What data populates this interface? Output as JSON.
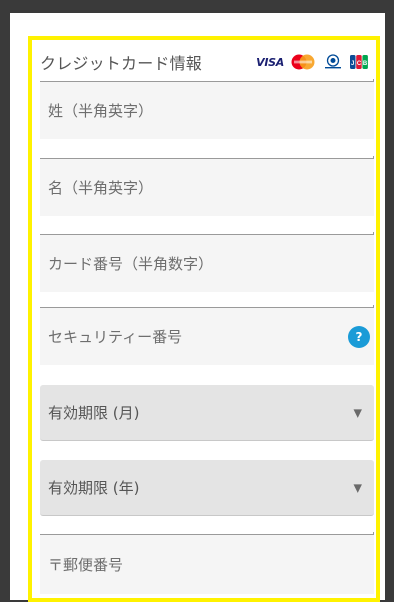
{
  "form": {
    "title": "クレジットカード情報",
    "card_brands": {
      "visa": "VISA"
    },
    "fields": {
      "last_name": {
        "placeholder": "姓（半角英字）"
      },
      "first_name": {
        "placeholder": "名（半角英字）"
      },
      "card_number": {
        "placeholder": "カード番号（半角数字）"
      },
      "security_code": {
        "placeholder": "セキュリティー番号",
        "help": "?"
      },
      "exp_month": {
        "value": "有効期限 (月)"
      },
      "exp_year": {
        "value": "有効期限 (年)"
      },
      "postal_code": {
        "placeholder": "〒郵便番号"
      }
    },
    "select_arrow": "▼"
  },
  "colors": {
    "highlight_border": "#fff200",
    "help_badge": "#1a9bd7",
    "field_bg": "#f5f5f5",
    "select_bg": "#e4e4e4"
  },
  "icons": [
    "visa-logo-icon",
    "mastercard-logo-icon",
    "diners-club-logo-icon",
    "jcb-logo-icon",
    "question-icon",
    "chevron-down-icon"
  ]
}
